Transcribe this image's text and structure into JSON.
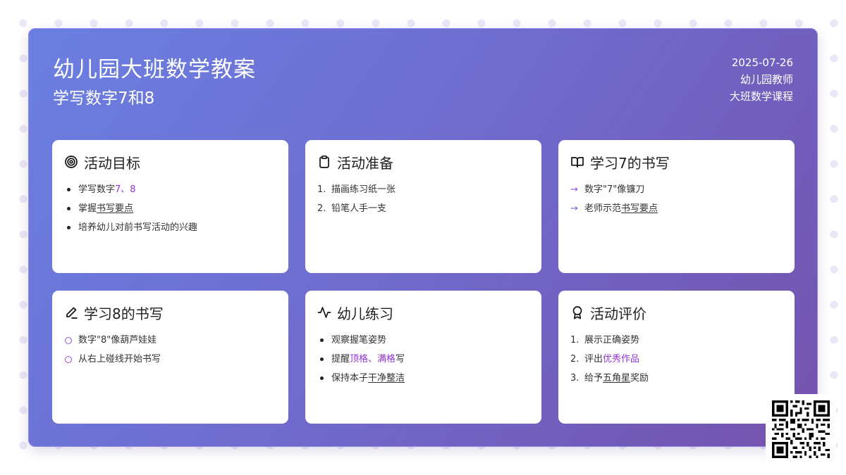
{
  "header": {
    "title": "幼儿园大班数学教案",
    "subtitle": "学写数字7和8",
    "date": "2025-07-26",
    "author": "幼儿园教师",
    "course": "大班数学课程"
  },
  "colors": {
    "gradient_start": "#6a7fe1",
    "gradient_end": "#7452ad",
    "accent": "#9233d6"
  },
  "cards": [
    {
      "title": "活动目标",
      "icon": "target-icon",
      "items": [
        {
          "a": "学写数字",
          "b": "7、8"
        },
        {
          "a": "掌握",
          "b": "书写要点"
        },
        {
          "a": "培养幼儿对前书写活动的兴趣"
        }
      ]
    },
    {
      "title": "活动准备",
      "icon": "clipboard-icon",
      "items": [
        {
          "n": "1.",
          "a": "描画练习纸一张"
        },
        {
          "n": "2.",
          "a": "铅笔人手一支"
        }
      ]
    },
    {
      "title": "学习7的书写",
      "icon": "book-open-icon",
      "items": [
        {
          "m": "→",
          "a": "数字\"7\"像镰刀"
        },
        {
          "m": "→",
          "a": "老师示范",
          "b": "书写要点"
        }
      ]
    },
    {
      "title": "学习8的书写",
      "icon": "pencil-icon",
      "items": [
        {
          "a": "数字\"8\"像葫芦娃娃"
        },
        {
          "a": "从右上碰线开始书写"
        }
      ]
    },
    {
      "title": "幼儿练习",
      "icon": "activity-icon",
      "items": [
        {
          "a": "观察握笔姿势"
        },
        {
          "a": "提醒",
          "b": "顶格、满格",
          "c": "写"
        },
        {
          "a": "保持本子",
          "b": "干净整洁"
        }
      ]
    },
    {
      "title": "活动评价",
      "icon": "award-icon",
      "items": [
        {
          "n": "1.",
          "a": "展示正确姿势"
        },
        {
          "n": "2.",
          "a": "评出",
          "b": "优秀作品"
        },
        {
          "n": "3.",
          "a": "给予",
          "b": "五角星",
          "c": "奖励"
        }
      ]
    }
  ]
}
